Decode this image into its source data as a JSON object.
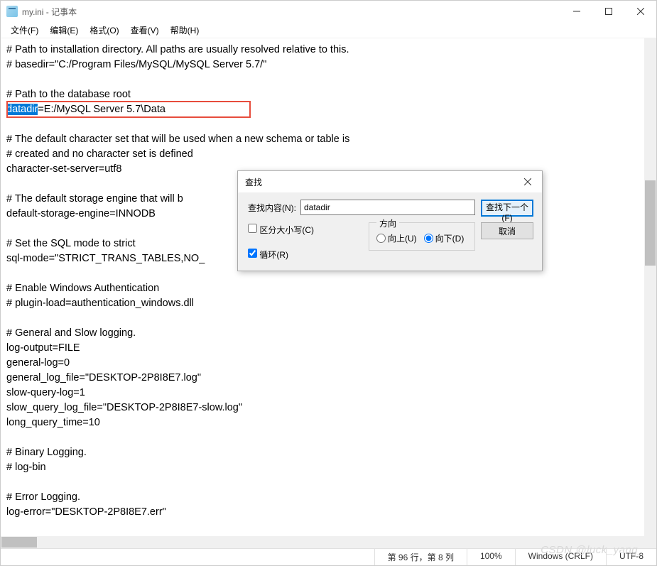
{
  "title": "my.ini - 记事本",
  "menu": {
    "file": "文件(F)",
    "edit": "编辑(E)",
    "format": "格式(O)",
    "view": "查看(V)",
    "help": "帮助(H)"
  },
  "content": {
    "l1": "# Path to installation directory. All paths are usually resolved relative to this.",
    "l2": "# basedir=\"C:/Program Files/MySQL/MySQL Server 5.7/\"",
    "l3": "",
    "l4": "# Path to the database root",
    "l5_sel": "datadir",
    "l5_rest": "=E:/MySQL Server 5.7\\Data",
    "l6": "",
    "l7": "# The default character set that will be used when a new schema or table is",
    "l8": "# created and no character set is defined",
    "l9": "character-set-server=utf8",
    "l10": "",
    "l11": "# The default storage engine that will b",
    "l12": "default-storage-engine=INNODB",
    "l13": "",
    "l14": "# Set the SQL mode to strict",
    "l15": "sql-mode=\"STRICT_TRANS_TABLES,NO_",
    "l16": "",
    "l17": "# Enable Windows Authentication",
    "l18": "# plugin-load=authentication_windows.dll",
    "l19": "",
    "l20": "# General and Slow logging.",
    "l21": "log-output=FILE",
    "l22": "general-log=0",
    "l23": "general_log_file=\"DESKTOP-2P8I8E7.log\"",
    "l24": "slow-query-log=1",
    "l25": "slow_query_log_file=\"DESKTOP-2P8I8E7-slow.log\"",
    "l26": "long_query_time=10",
    "l27": "",
    "l28": "# Binary Logging.",
    "l29": "# log-bin",
    "l30": "",
    "l31": "# Error Logging.",
    "l32": "log-error=\"DESKTOP-2P8I8E7.err\""
  },
  "dialog": {
    "title": "查找",
    "find_what_label": "查找内容(N):",
    "find_what_value": "datadir",
    "direction_label": "方向",
    "up_label": "向上(U)",
    "down_label": "向下(D)",
    "match_case_label": "区分大小写(C)",
    "wrap_label": "循环(R)",
    "find_next": "查找下一个(F)",
    "cancel": "取消"
  },
  "status": {
    "pos": "第 96 行，第 8 列",
    "zoom": "100%",
    "eol": "Windows (CRLF)",
    "enc": "UTF-8"
  },
  "watermark": "CSDN @luck_yang_"
}
